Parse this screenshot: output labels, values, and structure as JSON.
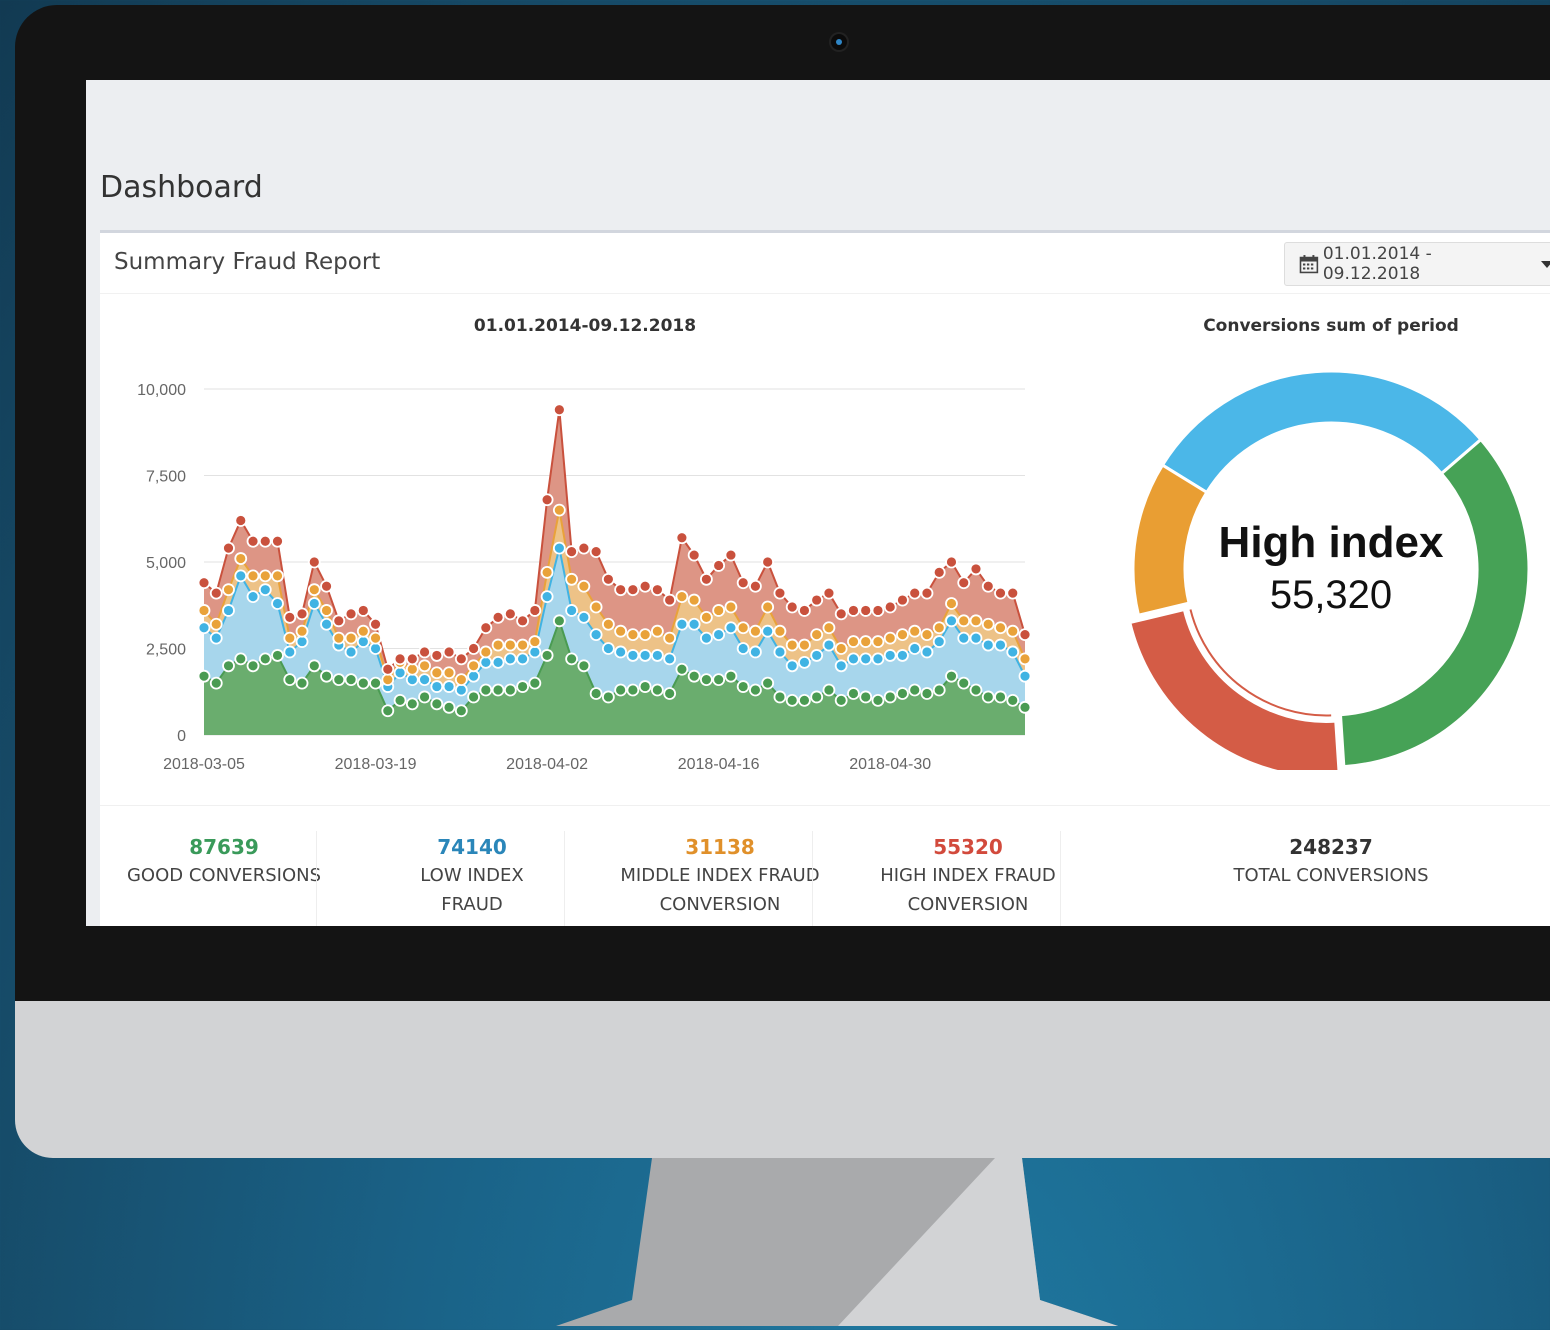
{
  "page": {
    "title": "Dashboard"
  },
  "panel": {
    "title": "Summary Fraud Report",
    "date_range": "01.01.2014 - 09.12.2018"
  },
  "colors": {
    "good": "#5a9e5f",
    "low": "#49b6e0",
    "middle": "#e69c36",
    "high": "#cc5a46"
  },
  "stats": [
    {
      "value": "87639",
      "label": "GOOD CONVERSIONS",
      "color": "#3a9a5a"
    },
    {
      "value": "74140",
      "label": "LOW INDEX FRAUD CONVERSION",
      "color": "#2a86b9"
    },
    {
      "value": "31138",
      "label": "MIDDLE INDEX FRAUD CONVERSION",
      "color": "#e0902a"
    },
    {
      "value": "55320",
      "label": "HIGH INDEX FRAUD CONVERSION",
      "color": "#d24a3c"
    },
    {
      "value": "248237",
      "label": "TOTAL CONVERSIONS",
      "color": "#333333"
    }
  ],
  "donut": {
    "label_title": "High index",
    "label_value": "55,320"
  },
  "chart_data": [
    {
      "type": "area",
      "title": "01.01.2014-09.12.2018",
      "ylim": [
        0,
        10000
      ],
      "yticks": [
        "0",
        "2,500",
        "5,000",
        "7,500",
        "10,000"
      ],
      "xtick_labels": [
        "2018-03-05",
        "2018-03-19",
        "2018-04-02",
        "2018-04-16",
        "2018-04-30"
      ],
      "xtick_indices": [
        0,
        14,
        28,
        42,
        56
      ],
      "stacked": true,
      "series": [
        {
          "name": "GOOD CONVERSIONS",
          "color": "#6aad6e",
          "values": [
            1700,
            1500,
            2000,
            2200,
            2000,
            2200,
            2300,
            1600,
            1500,
            2000,
            1700,
            1600,
            1600,
            1500,
            1500,
            700,
            1000,
            900,
            1100,
            900,
            800,
            700,
            1100,
            1300,
            1300,
            1300,
            1400,
            1500,
            2300,
            3300,
            2200,
            2000,
            1200,
            1100,
            1300,
            1300,
            1400,
            1300,
            1200,
            1900,
            1700,
            1600,
            1600,
            1700,
            1400,
            1300,
            1500,
            1100,
            1000,
            1000,
            1100,
            1300,
            1000,
            1200,
            1100,
            1000,
            1100,
            1200,
            1300,
            1200,
            1300,
            1700,
            1500,
            1300,
            1100,
            1100,
            1000,
            800
          ]
        },
        {
          "name": "LOW INDEX FRAUD CONVERSION",
          "color": "#a7d6ec",
          "values": [
            1400,
            1300,
            1600,
            2400,
            2000,
            2000,
            1500,
            800,
            1200,
            1800,
            1500,
            1000,
            800,
            1200,
            1000,
            700,
            800,
            700,
            500,
            500,
            600,
            600,
            600,
            800,
            800,
            900,
            800,
            900,
            1700,
            2100,
            1400,
            1400,
            1700,
            1400,
            1100,
            1000,
            900,
            1000,
            1000,
            1300,
            1500,
            1200,
            1300,
            1400,
            1100,
            1100,
            1500,
            1300,
            1000,
            1100,
            1200,
            1300,
            1000,
            1000,
            1100,
            1200,
            1200,
            1100,
            1200,
            1200,
            1400,
            1600,
            1300,
            1500,
            1500,
            1500,
            1400,
            900
          ]
        },
        {
          "name": "MIDDLE INDEX FRAUD CONVERSION",
          "color": "#edc287",
          "values": [
            500,
            400,
            600,
            500,
            600,
            400,
            800,
            400,
            300,
            400,
            400,
            200,
            400,
            300,
            300,
            200,
            300,
            300,
            400,
            400,
            400,
            300,
            300,
            300,
            500,
            400,
            400,
            300,
            700,
            1100,
            900,
            900,
            800,
            700,
            600,
            600,
            600,
            700,
            600,
            800,
            700,
            600,
            700,
            600,
            600,
            600,
            700,
            600,
            600,
            500,
            600,
            500,
            500,
            500,
            500,
            500,
            500,
            600,
            500,
            500,
            400,
            500,
            500,
            500,
            600,
            500,
            600,
            500
          ]
        },
        {
          "name": "HIGH INDEX FRAUD CONVERSION",
          "color": "#dd9585",
          "values": [
            800,
            900,
            1200,
            1100,
            1000,
            1000,
            1000,
            600,
            500,
            800,
            700,
            500,
            700,
            600,
            400,
            300,
            100,
            300,
            400,
            500,
            600,
            600,
            500,
            700,
            800,
            900,
            700,
            900,
            2100,
            2900,
            800,
            1100,
            1600,
            1300,
            1200,
            1300,
            1400,
            1200,
            1100,
            1700,
            1300,
            1100,
            1300,
            1500,
            1300,
            1300,
            1300,
            1100,
            1100,
            1000,
            1000,
            1000,
            1000,
            900,
            900,
            900,
            900,
            1000,
            1100,
            1200,
            1600,
            1200,
            1100,
            1500,
            1100,
            1000,
            1100,
            700
          ]
        }
      ]
    },
    {
      "type": "pie",
      "title": "Conversions sum of period",
      "categories": [
        "LOW INDEX FRAUD CONVERSION",
        "GOOD CONVERSIONS",
        "HIGH INDEX FRAUD CONVERSION",
        "MIDDLE INDEX FRAUD CONVERSION"
      ],
      "values": [
        74140,
        87639,
        55320,
        31138
      ],
      "colors": [
        "#4bb7e8",
        "#46a256",
        "#d45c46",
        "#e99e33"
      ],
      "highlighted": "HIGH INDEX FRAUD CONVERSION"
    }
  ]
}
